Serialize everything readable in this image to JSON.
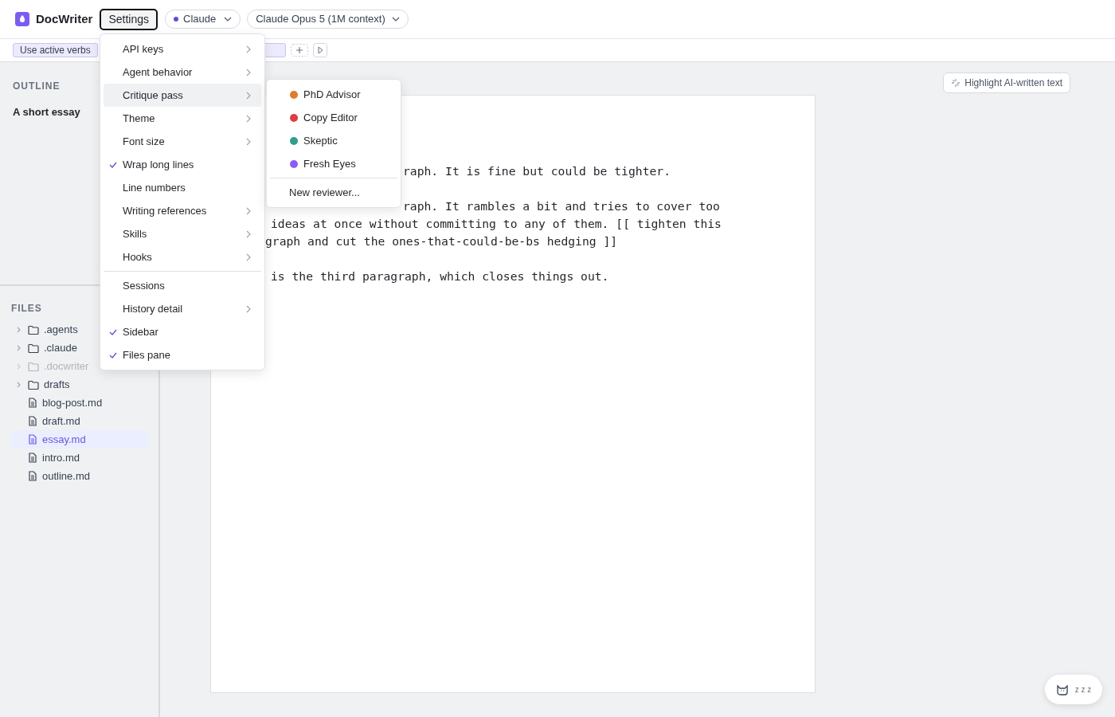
{
  "app": {
    "name": "DocWriter"
  },
  "header": {
    "settings_button": {
      "label": "Settings",
      "selected": true
    },
    "provider": {
      "label": "Claude",
      "color": "#5b4fd6"
    },
    "model": {
      "label": "Claude Opus 5 (1M context)"
    }
  },
  "prompt_chips": [
    {
      "label": "Use active verbs"
    },
    {
      "kind": "covered"
    }
  ],
  "outline": {
    "title": "OUTLINE",
    "items": [
      "A short essay"
    ]
  },
  "files": {
    "title": "FILES",
    "items": [
      {
        "name": ".agents",
        "kind": "folder",
        "dimmed": false,
        "selected": false
      },
      {
        "name": ".claude",
        "kind": "folder",
        "dimmed": false,
        "selected": false
      },
      {
        "name": ".docwriter",
        "kind": "folder",
        "dimmed": true,
        "selected": false
      },
      {
        "name": "drafts",
        "kind": "folder",
        "dimmed": false,
        "selected": false
      },
      {
        "name": "blog-post.md",
        "kind": "file",
        "dimmed": false,
        "selected": false
      },
      {
        "name": "draft.md",
        "kind": "file",
        "dimmed": false,
        "selected": false
      },
      {
        "name": "essay.md",
        "kind": "file",
        "dimmed": false,
        "selected": true
      },
      {
        "name": "intro.md",
        "kind": "file",
        "dimmed": false,
        "selected": false
      },
      {
        "name": "outline.md",
        "kind": "file",
        "dimmed": false,
        "selected": false
      }
    ]
  },
  "highlight_button": {
    "label": "Highlight AI-written text"
  },
  "editor": {
    "paragraphs": [
      [
        "raph. It is fine but could be tighter."
      ],
      [
        "raph. It rambles a bit and tries to cover too",
        "ideas at once without committing to any of them. [[ tighten this",
        "graph and cut the ones-that-could-be-bs hedging ]]"
      ],
      [
        "is the third paragraph, which closes things out."
      ]
    ]
  },
  "settings_menu": {
    "items": [
      {
        "kind": "item",
        "label": "API keys",
        "checked": false,
        "submenu": true,
        "selected": false
      },
      {
        "kind": "item",
        "label": "Agent behavior",
        "checked": false,
        "submenu": true,
        "selected": false
      },
      {
        "kind": "item",
        "label": "Critique pass",
        "checked": false,
        "submenu": true,
        "selected": true
      },
      {
        "kind": "item",
        "label": "Theme",
        "checked": false,
        "submenu": true,
        "selected": false
      },
      {
        "kind": "item",
        "label": "Font size",
        "checked": false,
        "submenu": true,
        "selected": false
      },
      {
        "kind": "item",
        "label": "Wrap long lines",
        "checked": true,
        "submenu": false,
        "selected": false
      },
      {
        "kind": "item",
        "label": "Line numbers",
        "checked": false,
        "submenu": false,
        "selected": false
      },
      {
        "kind": "item",
        "label": "Writing references",
        "checked": false,
        "submenu": true,
        "selected": false
      },
      {
        "kind": "item",
        "label": "Skills",
        "checked": false,
        "submenu": true,
        "selected": false
      },
      {
        "kind": "item",
        "label": "Hooks",
        "checked": false,
        "submenu": true,
        "selected": false
      },
      {
        "kind": "separator"
      },
      {
        "kind": "item",
        "label": "Sessions",
        "checked": false,
        "submenu": false,
        "selected": false
      },
      {
        "kind": "item",
        "label": "History detail",
        "checked": false,
        "submenu": true,
        "selected": false
      },
      {
        "kind": "item",
        "label": "Sidebar",
        "checked": true,
        "submenu": false,
        "selected": false
      },
      {
        "kind": "item",
        "label": "Files pane",
        "checked": true,
        "submenu": false,
        "selected": false
      }
    ]
  },
  "critique_submenu": {
    "items": [
      {
        "kind": "reviewer",
        "label": "PhD Advisor",
        "color": "#e07b2a"
      },
      {
        "kind": "reviewer",
        "label": "Copy Editor",
        "color": "#dc3f3f"
      },
      {
        "kind": "reviewer",
        "label": "Skeptic",
        "color": "#2f9e8a"
      },
      {
        "kind": "reviewer",
        "label": "Fresh Eyes",
        "color": "#8b5cf6"
      },
      {
        "kind": "separator"
      },
      {
        "kind": "action",
        "label": "New reviewer..."
      }
    ]
  },
  "status_bubble": {
    "text": "z z z"
  }
}
